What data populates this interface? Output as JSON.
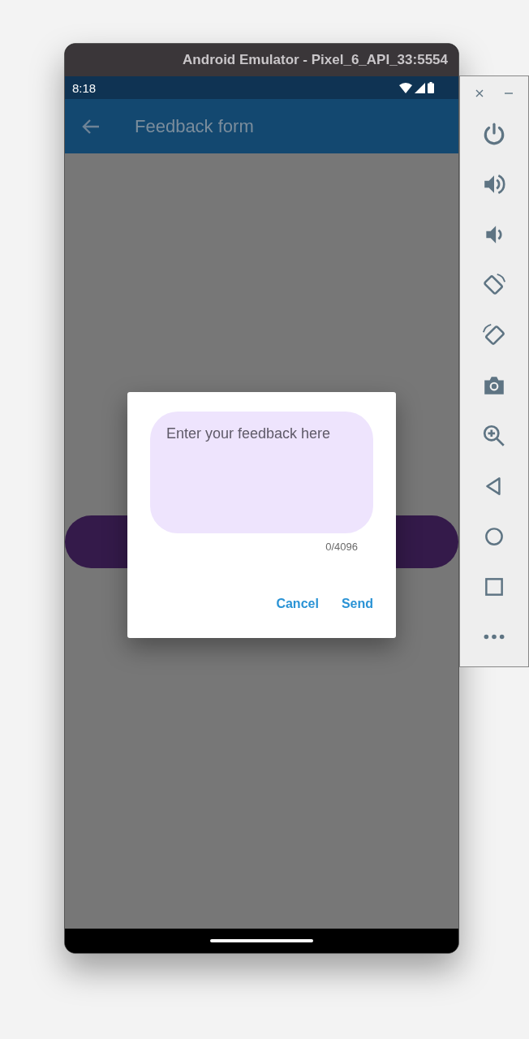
{
  "window": {
    "title": "Android Emulator - Pixel_6_API_33:5554"
  },
  "status_bar": {
    "time": "8:18"
  },
  "app_bar": {
    "title": "Feedback form"
  },
  "dialog": {
    "field": {
      "placeholder": "Enter your feedback here",
      "counter": "0/4096"
    },
    "buttons": [
      "Cancel",
      "Send"
    ]
  }
}
